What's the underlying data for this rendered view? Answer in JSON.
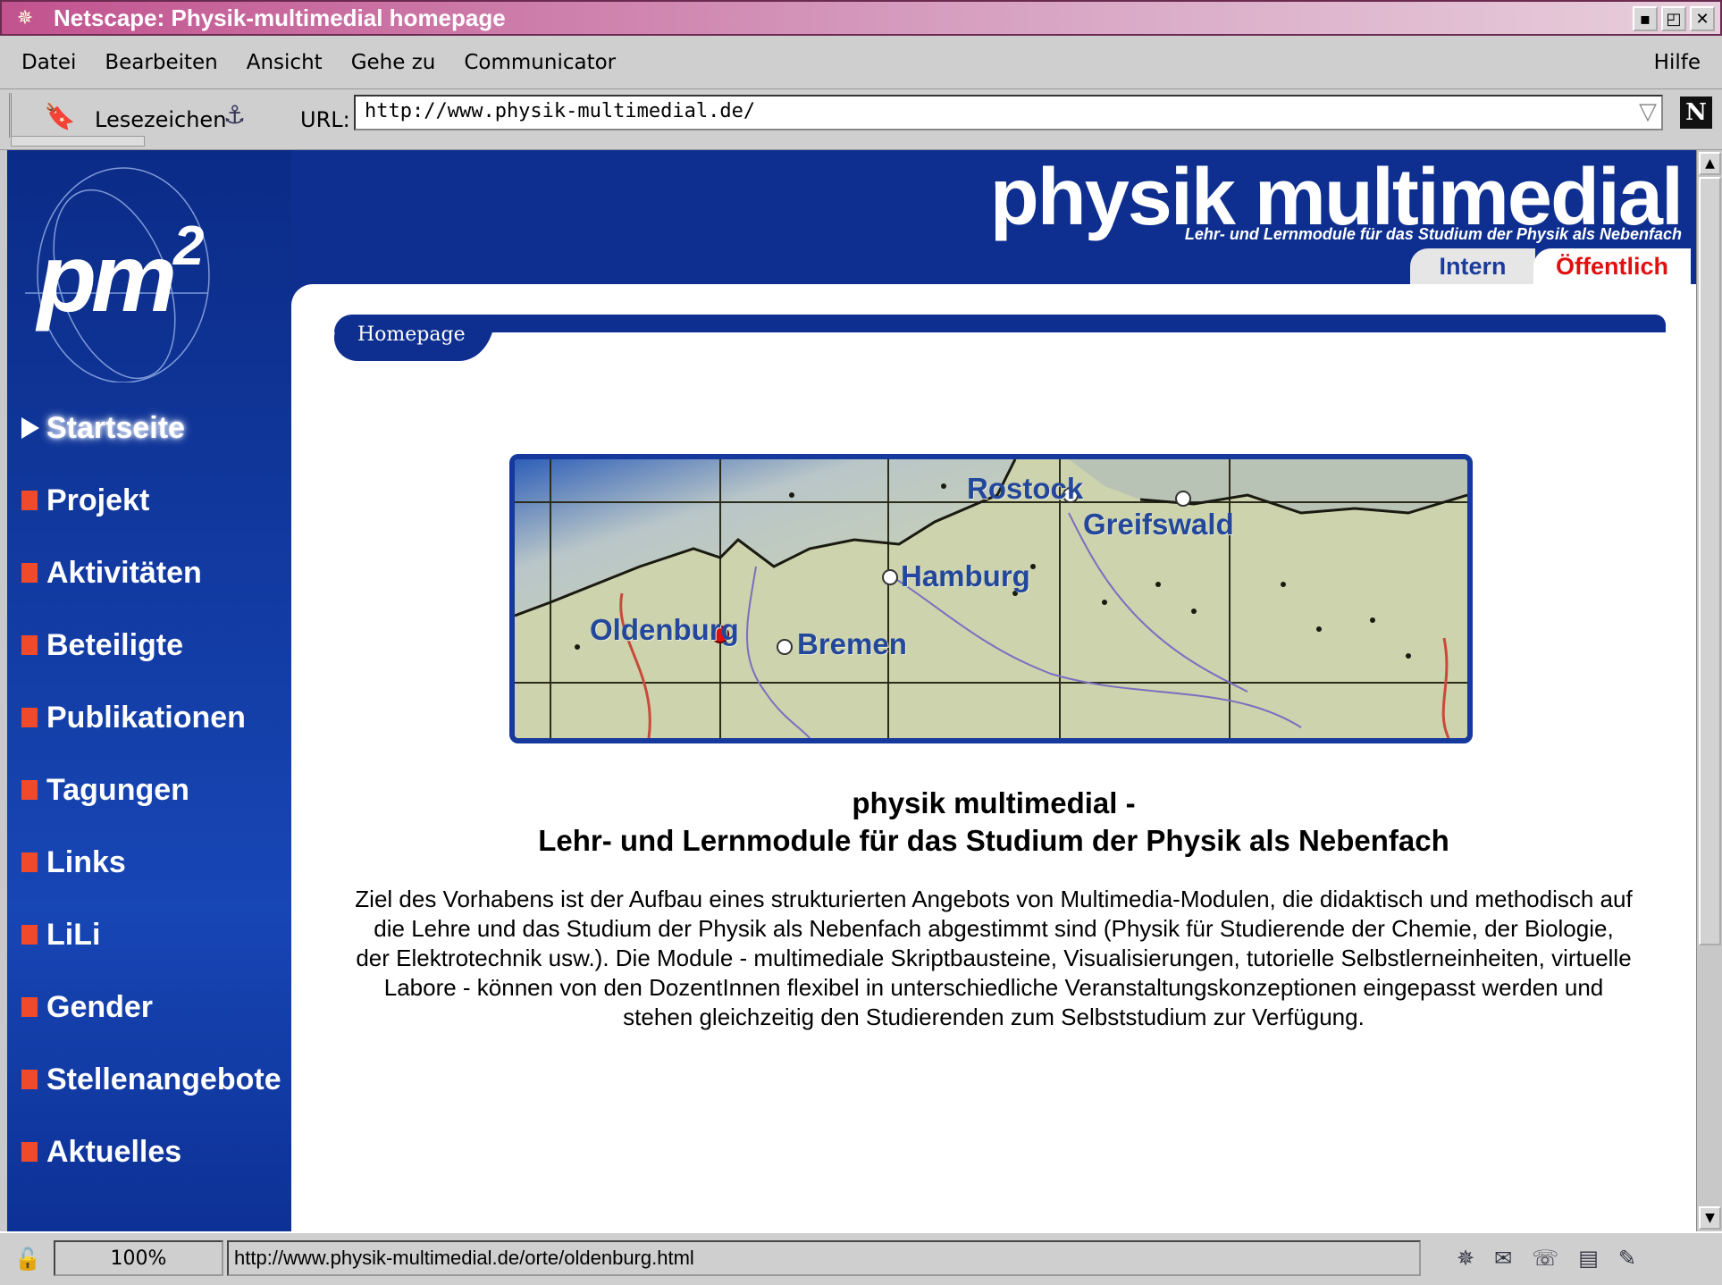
{
  "window": {
    "title": "Netscape: Physik-multimedial homepage",
    "controls": [
      "▪",
      "◰",
      "✕"
    ]
  },
  "menu": {
    "items": [
      "Datei",
      "Bearbeiten",
      "Ansicht",
      "Gehe zu",
      "Communicator"
    ],
    "help": "Hilfe"
  },
  "location": {
    "bookmarks_label": "Lesezeichen",
    "url_label": "URL:",
    "url_value": "http://www.physik-multimedial.de/"
  },
  "header": {
    "brand": "physik multimedial",
    "brand_sub": "Lehr- und Lernmodule für das Studium der Physik als Nebenfach",
    "tab_intern": "Intern",
    "tab_oeffentlich": "Öffentlich"
  },
  "logo": {
    "text": "pm",
    "sup": "2"
  },
  "sidebar": {
    "items": [
      {
        "label": "Startseite",
        "active": true
      },
      {
        "label": "Projekt"
      },
      {
        "label": "Aktivitäten"
      },
      {
        "label": "Beteiligte"
      },
      {
        "label": "Publikationen"
      },
      {
        "label": "Tagungen"
      },
      {
        "label": "Links"
      },
      {
        "label": "LiLi"
      },
      {
        "label": "Gender"
      },
      {
        "label": "Stellenangebote"
      },
      {
        "label": "Aktuelles"
      }
    ]
  },
  "breadcrumb": {
    "label": "Homepage"
  },
  "map": {
    "cities": [
      "Rostock",
      "Greifswald",
      "Hamburg",
      "Oldenburg",
      "Bremen"
    ]
  },
  "main": {
    "headline_line1": "physik multimedial -",
    "headline_line2": "Lehr- und Lernmodule für das Studium der Physik als Nebenfach",
    "intro": "Ziel des Vorhabens ist der Aufbau eines strukturierten Angebots von Multimedia-Modulen, die didaktisch und methodisch auf die Lehre und das Studium der Physik als Nebenfach abgestimmt sind (Physik für Studierende der Chemie, der Biologie, der Elektrotechnik usw.). Die Module - multimediale Skriptbausteine, Visualisierungen, tutorielle Selbstlerneinheiten, virtuelle Labore - können von den DozentInnen flexibel in unterschiedliche Veranstaltungskonzeptionen eingepasst werden und stehen gleichzeitig den Studierenden zum Selbststudium zur Verfügung."
  },
  "status": {
    "zoom": "100%",
    "url": "http://www.physik-multimedial.de/orte/oldenburg.html"
  },
  "colors": {
    "nav_blue": "#0e2f8f",
    "bullet_red": "#f04a2a",
    "tab_red": "#e01010",
    "city_blue": "#23479b"
  }
}
